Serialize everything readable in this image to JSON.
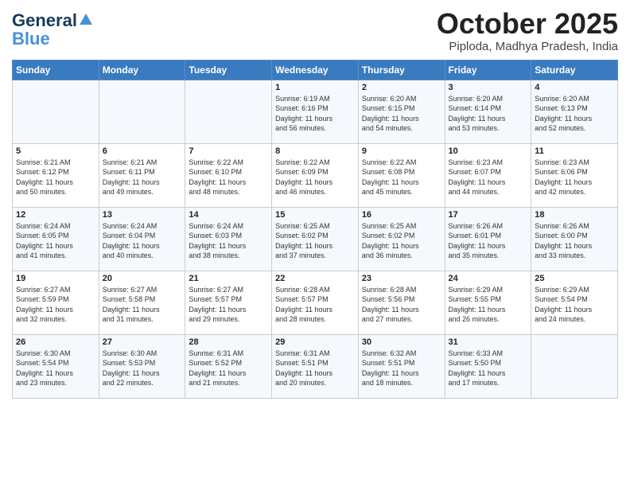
{
  "header": {
    "logo_general": "General",
    "logo_blue": "Blue",
    "month_title": "October 2025",
    "location": "Piploda, Madhya Pradesh, India"
  },
  "weekdays": [
    "Sunday",
    "Monday",
    "Tuesday",
    "Wednesday",
    "Thursday",
    "Friday",
    "Saturday"
  ],
  "weeks": [
    [
      {
        "day": "",
        "info": ""
      },
      {
        "day": "",
        "info": ""
      },
      {
        "day": "",
        "info": ""
      },
      {
        "day": "1",
        "info": "Sunrise: 6:19 AM\nSunset: 6:16 PM\nDaylight: 11 hours\nand 56 minutes."
      },
      {
        "day": "2",
        "info": "Sunrise: 6:20 AM\nSunset: 6:15 PM\nDaylight: 11 hours\nand 54 minutes."
      },
      {
        "day": "3",
        "info": "Sunrise: 6:20 AM\nSunset: 6:14 PM\nDaylight: 11 hours\nand 53 minutes."
      },
      {
        "day": "4",
        "info": "Sunrise: 6:20 AM\nSunset: 6:13 PM\nDaylight: 11 hours\nand 52 minutes."
      }
    ],
    [
      {
        "day": "5",
        "info": "Sunrise: 6:21 AM\nSunset: 6:12 PM\nDaylight: 11 hours\nand 50 minutes."
      },
      {
        "day": "6",
        "info": "Sunrise: 6:21 AM\nSunset: 6:11 PM\nDaylight: 11 hours\nand 49 minutes."
      },
      {
        "day": "7",
        "info": "Sunrise: 6:22 AM\nSunset: 6:10 PM\nDaylight: 11 hours\nand 48 minutes."
      },
      {
        "day": "8",
        "info": "Sunrise: 6:22 AM\nSunset: 6:09 PM\nDaylight: 11 hours\nand 46 minutes."
      },
      {
        "day": "9",
        "info": "Sunrise: 6:22 AM\nSunset: 6:08 PM\nDaylight: 11 hours\nand 45 minutes."
      },
      {
        "day": "10",
        "info": "Sunrise: 6:23 AM\nSunset: 6:07 PM\nDaylight: 11 hours\nand 44 minutes."
      },
      {
        "day": "11",
        "info": "Sunrise: 6:23 AM\nSunset: 6:06 PM\nDaylight: 11 hours\nand 42 minutes."
      }
    ],
    [
      {
        "day": "12",
        "info": "Sunrise: 6:24 AM\nSunset: 6:05 PM\nDaylight: 11 hours\nand 41 minutes."
      },
      {
        "day": "13",
        "info": "Sunrise: 6:24 AM\nSunset: 6:04 PM\nDaylight: 11 hours\nand 40 minutes."
      },
      {
        "day": "14",
        "info": "Sunrise: 6:24 AM\nSunset: 6:03 PM\nDaylight: 11 hours\nand 38 minutes."
      },
      {
        "day": "15",
        "info": "Sunrise: 6:25 AM\nSunset: 6:02 PM\nDaylight: 11 hours\nand 37 minutes."
      },
      {
        "day": "16",
        "info": "Sunrise: 6:25 AM\nSunset: 6:02 PM\nDaylight: 11 hours\nand 36 minutes."
      },
      {
        "day": "17",
        "info": "Sunrise: 6:26 AM\nSunset: 6:01 PM\nDaylight: 11 hours\nand 35 minutes."
      },
      {
        "day": "18",
        "info": "Sunrise: 6:26 AM\nSunset: 6:00 PM\nDaylight: 11 hours\nand 33 minutes."
      }
    ],
    [
      {
        "day": "19",
        "info": "Sunrise: 6:27 AM\nSunset: 5:59 PM\nDaylight: 11 hours\nand 32 minutes."
      },
      {
        "day": "20",
        "info": "Sunrise: 6:27 AM\nSunset: 5:58 PM\nDaylight: 11 hours\nand 31 minutes."
      },
      {
        "day": "21",
        "info": "Sunrise: 6:27 AM\nSunset: 5:57 PM\nDaylight: 11 hours\nand 29 minutes."
      },
      {
        "day": "22",
        "info": "Sunrise: 6:28 AM\nSunset: 5:57 PM\nDaylight: 11 hours\nand 28 minutes."
      },
      {
        "day": "23",
        "info": "Sunrise: 6:28 AM\nSunset: 5:56 PM\nDaylight: 11 hours\nand 27 minutes."
      },
      {
        "day": "24",
        "info": "Sunrise: 6:29 AM\nSunset: 5:55 PM\nDaylight: 11 hours\nand 26 minutes."
      },
      {
        "day": "25",
        "info": "Sunrise: 6:29 AM\nSunset: 5:54 PM\nDaylight: 11 hours\nand 24 minutes."
      }
    ],
    [
      {
        "day": "26",
        "info": "Sunrise: 6:30 AM\nSunset: 5:54 PM\nDaylight: 11 hours\nand 23 minutes."
      },
      {
        "day": "27",
        "info": "Sunrise: 6:30 AM\nSunset: 5:53 PM\nDaylight: 11 hours\nand 22 minutes."
      },
      {
        "day": "28",
        "info": "Sunrise: 6:31 AM\nSunset: 5:52 PM\nDaylight: 11 hours\nand 21 minutes."
      },
      {
        "day": "29",
        "info": "Sunrise: 6:31 AM\nSunset: 5:51 PM\nDaylight: 11 hours\nand 20 minutes."
      },
      {
        "day": "30",
        "info": "Sunrise: 6:32 AM\nSunset: 5:51 PM\nDaylight: 11 hours\nand 18 minutes."
      },
      {
        "day": "31",
        "info": "Sunrise: 6:33 AM\nSunset: 5:50 PM\nDaylight: 11 hours\nand 17 minutes."
      },
      {
        "day": "",
        "info": ""
      }
    ]
  ]
}
